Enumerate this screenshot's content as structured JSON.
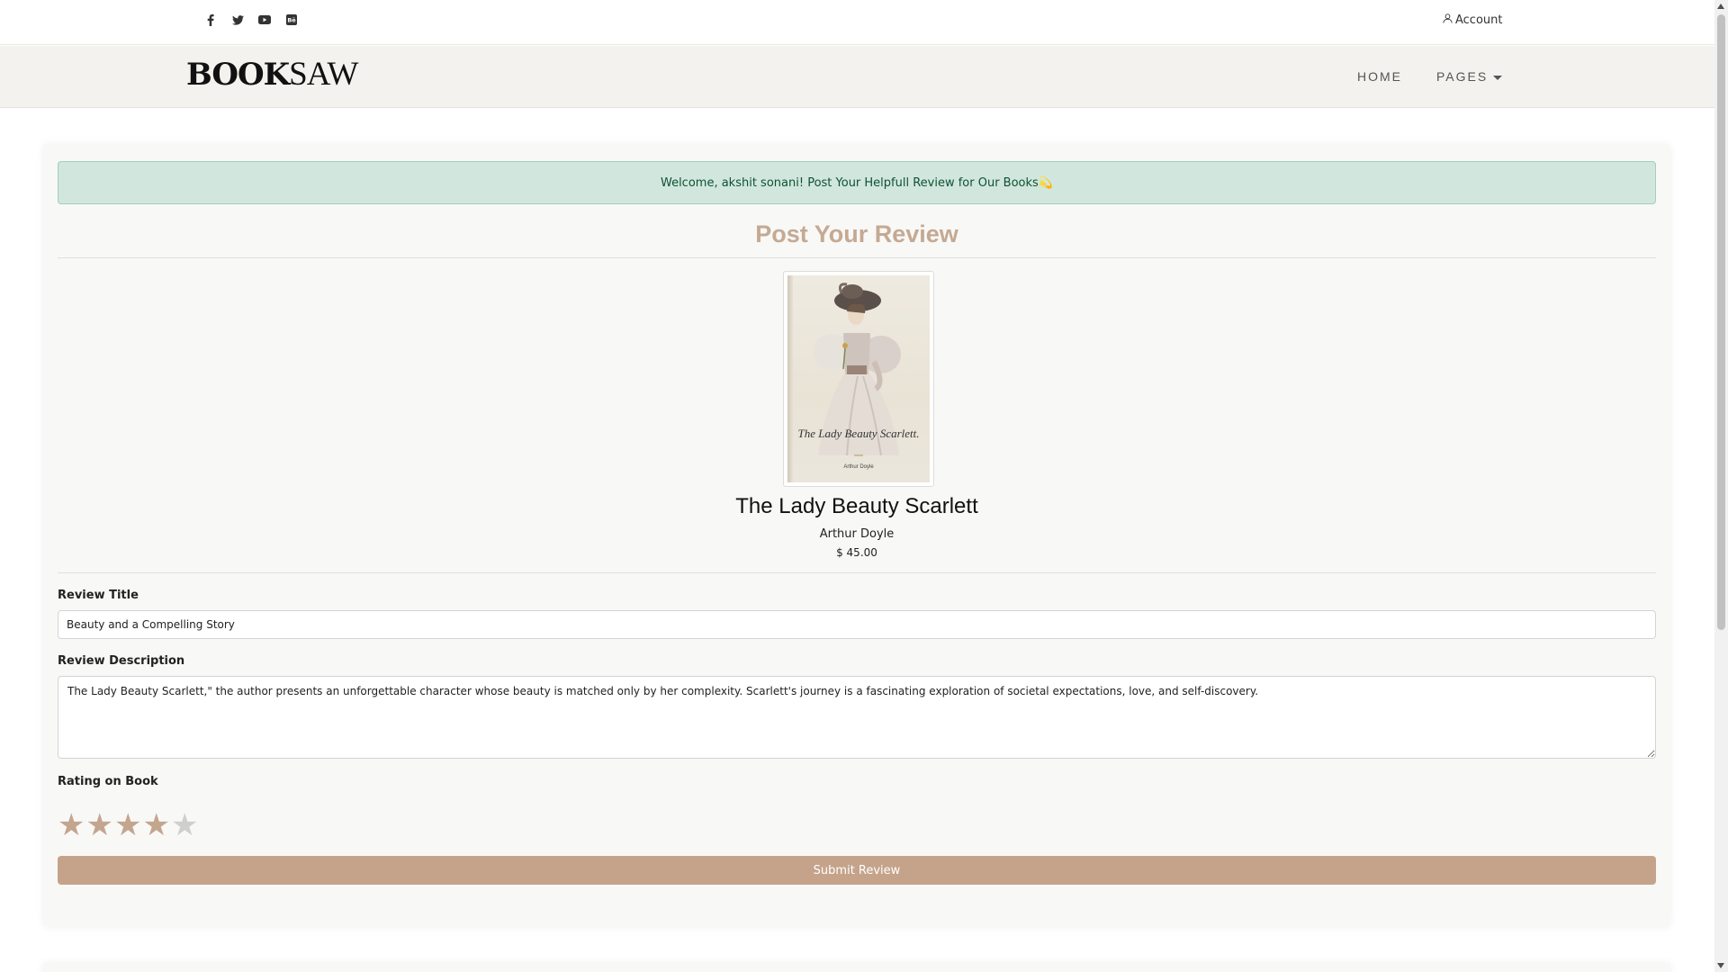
{
  "header": {
    "social_icons": [
      "facebook-icon",
      "twitter-icon",
      "youtube-icon",
      "behance-icon"
    ],
    "account_label": "Account"
  },
  "navbar": {
    "logo_bold": "BOOK",
    "logo_light": "SAW",
    "items": [
      {
        "label": "HOME"
      },
      {
        "label": "PAGES"
      }
    ]
  },
  "alert": {
    "message": "Welcome, akshit sonani! Post Your Helpfull Review for Our Books",
    "emoji": "💫"
  },
  "page_heading": "Post Your Review",
  "book": {
    "cover_title": "The Lady Beauty Scarlett.",
    "cover_author": "Arthur Doyle",
    "title": "The Lady Beauty Scarlett",
    "author": "Arthur Doyle",
    "price": "$ 45.00"
  },
  "form": {
    "title_label": "Review Title",
    "title_value": "Beauty and a Compelling Story",
    "description_label": "Review Description",
    "description_value": "The Lady Beauty Scarlett,\" the author presents an unforgettable character whose beauty is matched only by her complexity. Scarlett's journey is a fascinating exploration of societal expectations, love, and self-discovery.",
    "rating_label": "Rating on Book",
    "rating": 4,
    "rating_max": 5,
    "submit_label": "Submit Review"
  },
  "colors": {
    "accent": "#c5a38b",
    "star_filled": "#c4a58e",
    "star_empty": "#cfcfcf",
    "alert_bg": "#d1e7dd",
    "heading": "#c5a992"
  }
}
